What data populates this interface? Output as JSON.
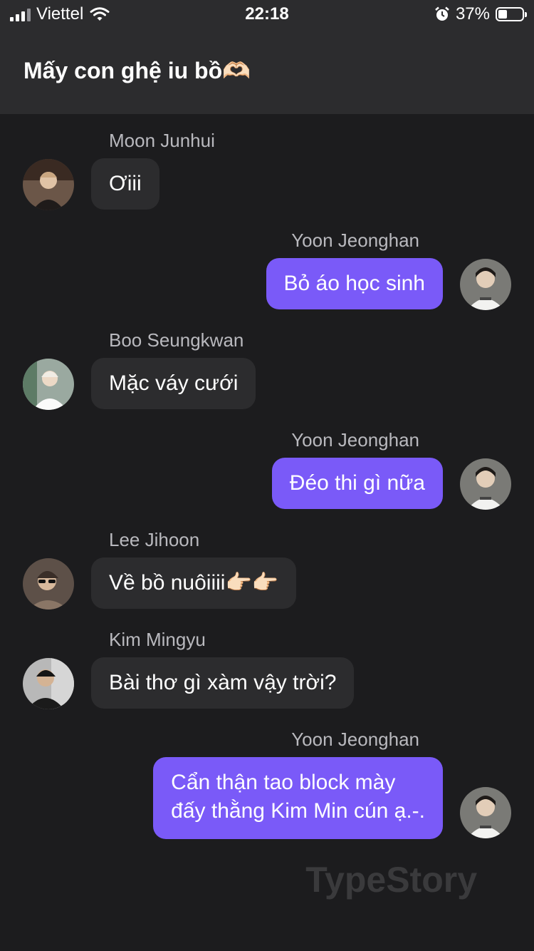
{
  "status_bar": {
    "carrier": "Viettel",
    "time": "22:18",
    "battery_percent": "37%",
    "battery_level": 0.37,
    "icons": [
      "signal-icon",
      "wifi-icon",
      "alarm-icon",
      "battery-icon"
    ]
  },
  "chat": {
    "title": "Mấy con ghệ iu bồ🫶🏻"
  },
  "messages": [
    {
      "direction": "incoming",
      "sender": "Moon Junhui",
      "text": "Ơiii",
      "avatar_color": "#6b5648"
    },
    {
      "direction": "outgoing",
      "sender": "Yoon Jeonghan",
      "text": "Bỏ áo học sinh",
      "avatar_color": "#7a7a76"
    },
    {
      "direction": "incoming",
      "sender": "Boo Seungkwan",
      "text": "Mặc váy cưới",
      "avatar_color": "#9aa9a0"
    },
    {
      "direction": "outgoing",
      "sender": "Yoon Jeonghan",
      "text": "Đéo thi gì nữa",
      "avatar_color": "#7a7a76"
    },
    {
      "direction": "incoming",
      "sender": "Lee Jihoon",
      "text": "Về bồ nuôiiii👉🏻👉🏻",
      "avatar_color": "#5d5048"
    },
    {
      "direction": "incoming",
      "sender": "Kim Mingyu",
      "text": "Bài thơ gì xàm vậy trời?",
      "avatar_color": "#4a4a4c"
    },
    {
      "direction": "outgoing",
      "sender": "Yoon Jeonghan",
      "text_lines": [
        "Cẩn thận tao block mày",
        "đấy thằng Kim Min cún ạ.-."
      ],
      "avatar_color": "#7a7a76"
    }
  ],
  "watermark": "TypeStory",
  "colors": {
    "background": "#1c1c1e",
    "header": "#2c2c2e",
    "incoming_bubble": "#2c2c2e",
    "outgoing_bubble": "#7a5af8",
    "sender_name": "#b9b9be"
  }
}
